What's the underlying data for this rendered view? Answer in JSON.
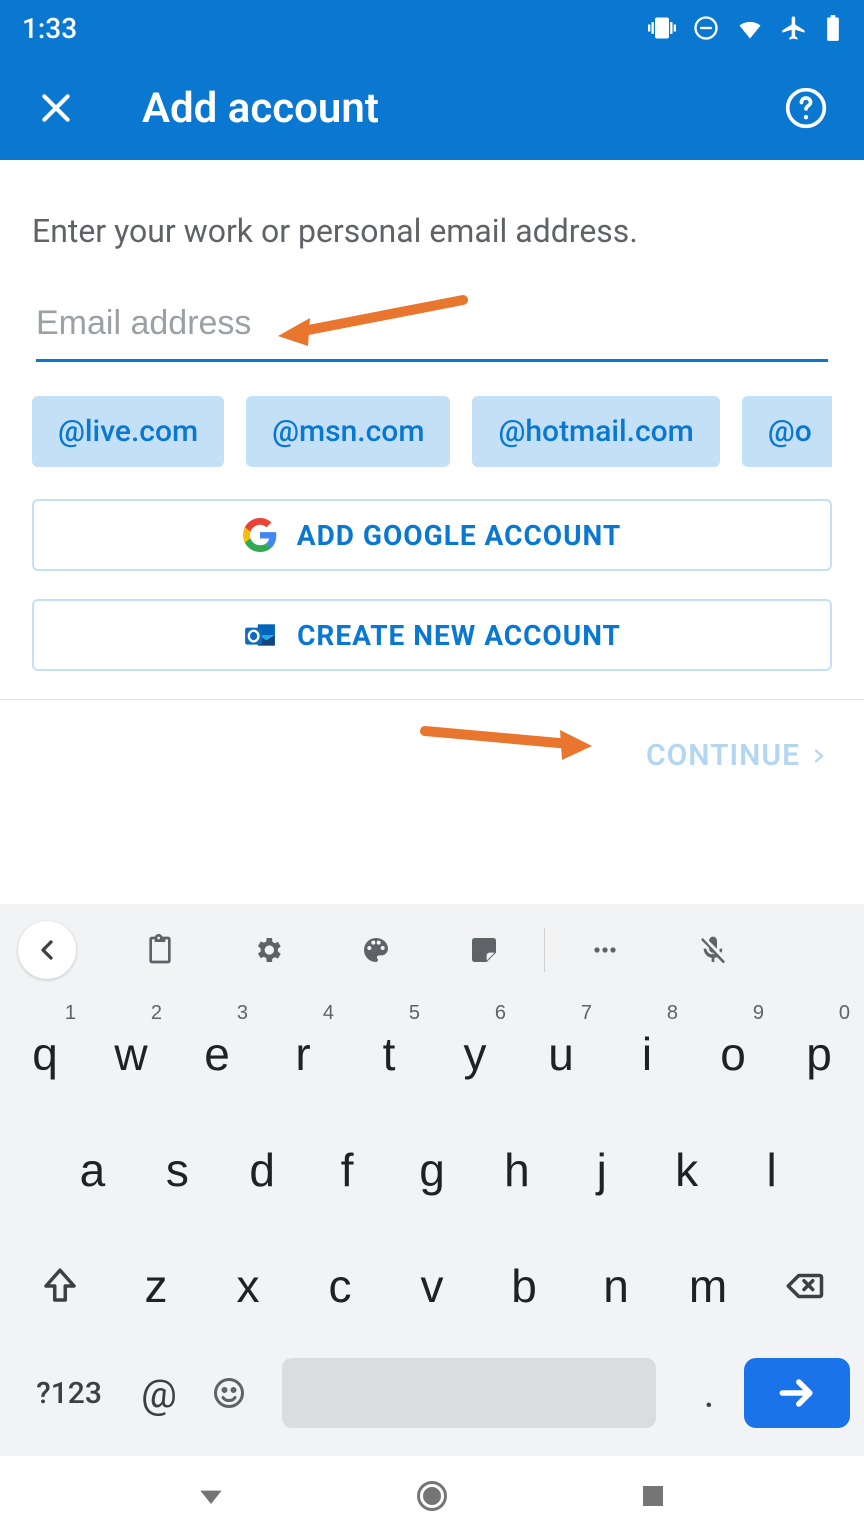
{
  "status": {
    "time": "1:33"
  },
  "header": {
    "title": "Add account"
  },
  "main": {
    "prompt": "Enter your work or personal email address.",
    "email_placeholder": "Email address",
    "email_value": "",
    "chips": [
      "@live.com",
      "@msn.com",
      "@hotmail.com",
      "@o"
    ],
    "google_button": "ADD GOOGLE ACCOUNT",
    "create_button": "CREATE NEW ACCOUNT",
    "continue": "CONTINUE"
  },
  "keyboard": {
    "row1": [
      {
        "k": "q",
        "n": "1"
      },
      {
        "k": "w",
        "n": "2"
      },
      {
        "k": "e",
        "n": "3"
      },
      {
        "k": "r",
        "n": "4"
      },
      {
        "k": "t",
        "n": "5"
      },
      {
        "k": "y",
        "n": "6"
      },
      {
        "k": "u",
        "n": "7"
      },
      {
        "k": "i",
        "n": "8"
      },
      {
        "k": "o",
        "n": "9"
      },
      {
        "k": "p",
        "n": "0"
      }
    ],
    "row2": [
      "a",
      "s",
      "d",
      "f",
      "g",
      "h",
      "j",
      "k",
      "l"
    ],
    "row3": [
      "z",
      "x",
      "c",
      "v",
      "b",
      "n",
      "m"
    ],
    "sym": "?123",
    "at": "@",
    "dot": "."
  }
}
